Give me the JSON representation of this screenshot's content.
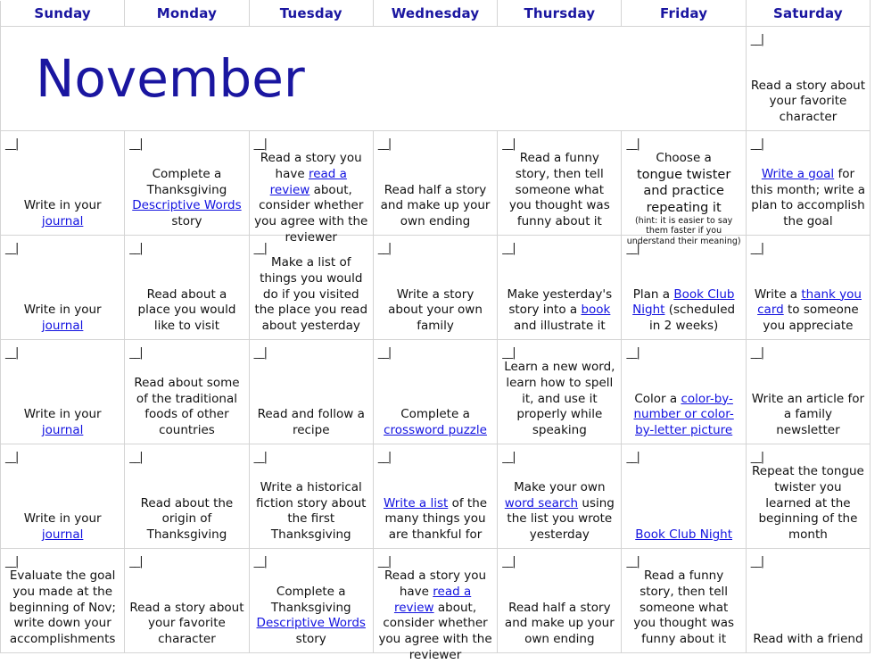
{
  "title": "November",
  "date_blank": "__|",
  "colors": {
    "heading": "#1a16a0",
    "link": "#1212e0",
    "text": "#111111",
    "grid": "#d4d4d4",
    "background": "#ffffff"
  },
  "weekdays": [
    "Sunday",
    "Monday",
    "Tuesday",
    "Wednesday",
    "Thursday",
    "Friday",
    "Saturday"
  ],
  "weeks": [
    {
      "cells": [
        {
          "kind": "month-title",
          "text": "November"
        },
        {
          "kind": "empty"
        },
        {
          "kind": "empty"
        },
        {
          "kind": "empty"
        },
        {
          "kind": "empty"
        },
        {
          "kind": "empty"
        },
        {
          "kind": "task",
          "parts": [
            {
              "type": "text",
              "value": "Read a story about your favorite character"
            }
          ]
        }
      ]
    },
    {
      "cells": [
        {
          "kind": "task",
          "parts": [
            {
              "type": "text",
              "value": "Write in your "
            },
            {
              "type": "link",
              "value": "journal"
            }
          ]
        },
        {
          "kind": "task",
          "parts": [
            {
              "type": "text",
              "value": "Complete a Thanksgiving "
            },
            {
              "type": "link",
              "value": "Descriptive Words"
            },
            {
              "type": "text",
              "value": " story"
            }
          ]
        },
        {
          "kind": "task",
          "flowtop": true,
          "parts": [
            {
              "type": "text",
              "value": "Read a story you have "
            },
            {
              "type": "link",
              "value": "read a review"
            },
            {
              "type": "text",
              "value": " about, consider whether you agree with the reviewer"
            }
          ]
        },
        {
          "kind": "task",
          "parts": [
            {
              "type": "text",
              "value": "Read half a story and make up your own ending"
            }
          ]
        },
        {
          "kind": "task",
          "parts": [
            {
              "type": "text",
              "value": "Read a funny story, then tell someone what you thought was funny about it"
            }
          ]
        },
        {
          "kind": "task-hint",
          "flowtop": true,
          "lead": "Choose a",
          "main": "tongue twister and practice repeating it",
          "hint": "(hint: it is easier to say them faster if you understand their meaning)"
        },
        {
          "kind": "task",
          "parts": [
            {
              "type": "link",
              "value": "Write a goal"
            },
            {
              "type": "text",
              "value": " for this month; write a plan to accomplish the goal"
            }
          ]
        }
      ]
    },
    {
      "cells": [
        {
          "kind": "task",
          "parts": [
            {
              "type": "text",
              "value": "Write in your "
            },
            {
              "type": "link",
              "value": "journal"
            }
          ]
        },
        {
          "kind": "task",
          "parts": [
            {
              "type": "text",
              "value": "Read about a place you would like to visit"
            }
          ]
        },
        {
          "kind": "task",
          "flowtop": true,
          "parts": [
            {
              "type": "text",
              "value": "Make a list of things you would do if you visited the place you read about yesterday"
            }
          ]
        },
        {
          "kind": "task",
          "parts": [
            {
              "type": "text",
              "value": "Write a story about your own family"
            }
          ]
        },
        {
          "kind": "task",
          "parts": [
            {
              "type": "text",
              "value": "Make yesterday's story into a "
            },
            {
              "type": "link",
              "value": "book"
            },
            {
              "type": "text",
              "value": " and illustrate it"
            }
          ]
        },
        {
          "kind": "task",
          "parts": [
            {
              "type": "text",
              "value": "Plan a "
            },
            {
              "type": "link",
              "value": "Book Club Night"
            },
            {
              "type": "text",
              "value": " (scheduled in 2 weeks)"
            }
          ]
        },
        {
          "kind": "task",
          "parts": [
            {
              "type": "text",
              "value": "Write a "
            },
            {
              "type": "link",
              "value": "thank you card"
            },
            {
              "type": "text",
              "value": " to someone you appreciate"
            }
          ]
        }
      ]
    },
    {
      "cells": [
        {
          "kind": "task",
          "parts": [
            {
              "type": "text",
              "value": "Write in your "
            },
            {
              "type": "link",
              "value": "journal"
            }
          ]
        },
        {
          "kind": "task",
          "parts": [
            {
              "type": "text",
              "value": "Read about some of the traditional foods of other countries"
            }
          ]
        },
        {
          "kind": "task",
          "parts": [
            {
              "type": "text",
              "value": "Read and follow a recipe"
            }
          ]
        },
        {
          "kind": "task",
          "parts": [
            {
              "type": "text",
              "value": "Complete a "
            },
            {
              "type": "link",
              "value": "crossword puzzle"
            }
          ]
        },
        {
          "kind": "task",
          "parts": [
            {
              "type": "text",
              "value": "Learn a new word, learn how to spell it, and use it properly while speaking"
            }
          ]
        },
        {
          "kind": "task",
          "parts": [
            {
              "type": "text",
              "value": "Color a "
            },
            {
              "type": "link",
              "value": "color-by-number or color-by-letter picture"
            }
          ]
        },
        {
          "kind": "task",
          "parts": [
            {
              "type": "text",
              "value": "Write an article for a family newsletter"
            }
          ]
        }
      ]
    },
    {
      "cells": [
        {
          "kind": "task",
          "parts": [
            {
              "type": "text",
              "value": "Write in your "
            },
            {
              "type": "link",
              "value": "journal"
            }
          ]
        },
        {
          "kind": "task",
          "parts": [
            {
              "type": "text",
              "value": "Read about the origin of Thanksgiving"
            }
          ]
        },
        {
          "kind": "task",
          "parts": [
            {
              "type": "text",
              "value": "Write a historical fiction story about the first Thanksgiving"
            }
          ]
        },
        {
          "kind": "task",
          "parts": [
            {
              "type": "link",
              "value": "Write a list"
            },
            {
              "type": "text",
              "value": " of the many things you are thankful for"
            }
          ]
        },
        {
          "kind": "task",
          "parts": [
            {
              "type": "text",
              "value": "Make your own "
            },
            {
              "type": "link",
              "value": "word search"
            },
            {
              "type": "text",
              "value": " using the list you wrote yesterday"
            }
          ]
        },
        {
          "kind": "task",
          "parts": [
            {
              "type": "link",
              "value": "Book Club Night"
            }
          ]
        },
        {
          "kind": "task",
          "parts": [
            {
              "type": "text",
              "value": "Repeat the tongue twister you learned at the beginning of the month"
            }
          ]
        }
      ]
    },
    {
      "cells": [
        {
          "kind": "task",
          "flowtop": true,
          "parts": [
            {
              "type": "text",
              "value": "Evaluate the goal you made at the beginning of Nov; write down your accomplishments"
            }
          ]
        },
        {
          "kind": "task",
          "parts": [
            {
              "type": "text",
              "value": "Read a story about your favorite character"
            }
          ]
        },
        {
          "kind": "task",
          "parts": [
            {
              "type": "text",
              "value": "Complete a Thanksgiving "
            },
            {
              "type": "link",
              "value": "Descriptive Words"
            },
            {
              "type": "text",
              "value": " story"
            }
          ]
        },
        {
          "kind": "task",
          "flowtop": true,
          "parts": [
            {
              "type": "text",
              "value": "Read a story you have "
            },
            {
              "type": "link",
              "value": "read a review"
            },
            {
              "type": "text",
              "value": " about, consider whether you agree with the reviewer"
            }
          ]
        },
        {
          "kind": "task",
          "parts": [
            {
              "type": "text",
              "value": "Read half a story and make up your own ending"
            }
          ]
        },
        {
          "kind": "task",
          "parts": [
            {
              "type": "text",
              "value": "Read a funny story, then tell someone what you thought was funny about it"
            }
          ]
        },
        {
          "kind": "task",
          "parts": [
            {
              "type": "text",
              "value": "Read with a friend"
            }
          ]
        }
      ]
    }
  ]
}
